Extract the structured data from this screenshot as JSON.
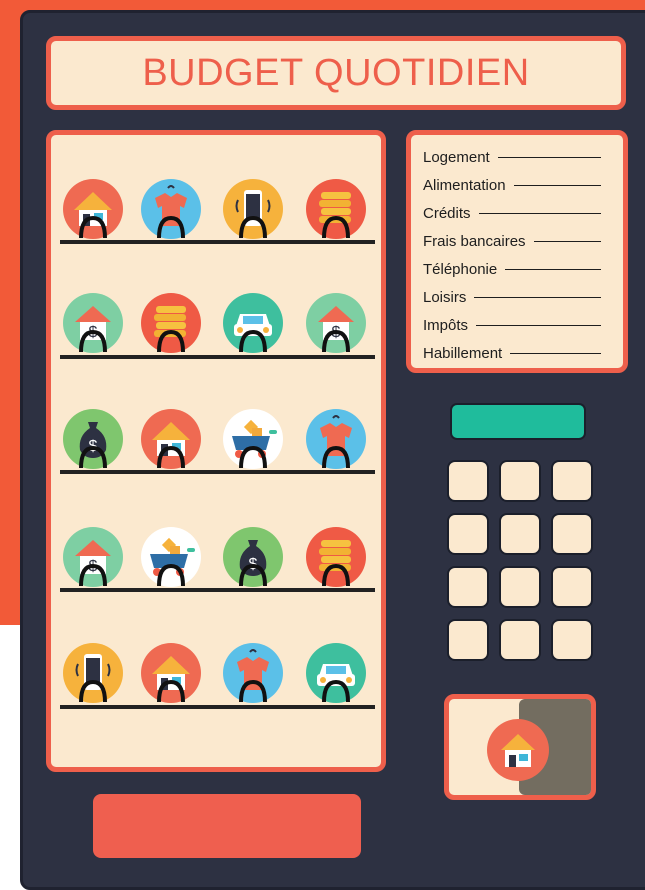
{
  "title": "BUDGET QUOTIDIEN",
  "legend": [
    "Logement",
    "Alimentation",
    "Crédits",
    "Frais bancaires",
    "Téléphonie",
    "Loisirs",
    "Impôts",
    "Habillement"
  ],
  "shelves": [
    [
      "house-icon",
      "shirt-icon",
      "phone-icon",
      "coins-icon"
    ],
    [
      "bank-house-icon",
      "coins-icon",
      "car-icon",
      "bank-house-icon"
    ],
    [
      "money-bag-icon",
      "house-icon",
      "cart-icon",
      "shirt-icon"
    ],
    [
      "bank-house-icon",
      "cart-icon",
      "money-bag-icon",
      "coins-icon"
    ],
    [
      "phone-icon",
      "house-icon",
      "shirt-icon",
      "car-icon"
    ]
  ],
  "keypad": {
    "rows": 4,
    "cols": 3
  },
  "colors": {
    "machine": "#2d3142",
    "panel": "#fbe9cf",
    "accent": "#ee5f4b",
    "screen": "#1fbc9c",
    "background": "#f25a38"
  }
}
